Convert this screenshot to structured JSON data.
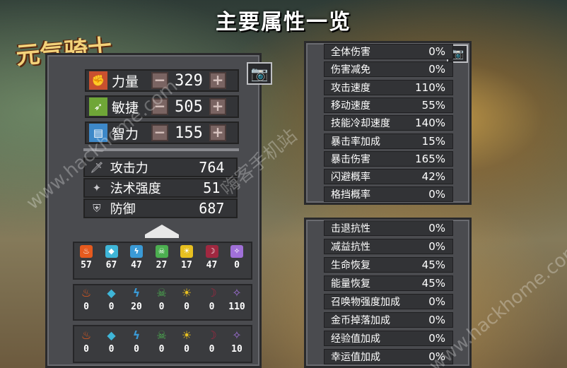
{
  "page_title": "主要属性一览",
  "logo_text": "元气骑士",
  "primary_stats": [
    {
      "icon": "fist-icon",
      "label": "力量",
      "value": "329",
      "color": "#c9502f"
    },
    {
      "icon": "feather-icon",
      "label": "敏捷",
      "value": "505",
      "color": "#6fa637"
    },
    {
      "icon": "book-icon",
      "label": "智力",
      "value": "155",
      "color": "#3d88c8"
    }
  ],
  "derived_stats": [
    {
      "icon": "sword-icon",
      "label": "攻击力",
      "value": "764"
    },
    {
      "icon": "wand-icon",
      "label": "法术强度",
      "value": "51"
    },
    {
      "icon": "shield-icon",
      "label": "防御",
      "value": "687"
    }
  ],
  "element_rows": [
    {
      "name": "shields",
      "values": [
        "57",
        "67",
        "47",
        "27",
        "17",
        "47",
        "0"
      ]
    },
    {
      "name": "elements",
      "values": [
        "0",
        "0",
        "20",
        "0",
        "0",
        "0",
        "110"
      ]
    },
    {
      "name": "weapons",
      "values": [
        "0",
        "0",
        "0",
        "0",
        "0",
        "0",
        "10"
      ]
    }
  ],
  "element_icons": [
    {
      "icon": "fire-icon",
      "color": "#e65a1e"
    },
    {
      "icon": "ice-icon",
      "color": "#3fb6d8"
    },
    {
      "icon": "lightning-icon",
      "color": "#3a9ad6"
    },
    {
      "icon": "poison-icon",
      "color": "#4caf50"
    },
    {
      "icon": "light-icon",
      "color": "#e8c020"
    },
    {
      "icon": "dark-icon",
      "color": "#a02840"
    },
    {
      "icon": "arcane-icon",
      "color": "#a070d8"
    }
  ],
  "attributes_top": [
    {
      "label": "全体伤害",
      "value": "0%"
    },
    {
      "label": "伤害减免",
      "value": "0%"
    },
    {
      "label": "攻击速度",
      "value": "110%"
    },
    {
      "label": "移动速度",
      "value": "55%"
    },
    {
      "label": "技能冷却速度",
      "value": "140%"
    },
    {
      "label": "暴击率加成",
      "value": "15%"
    },
    {
      "label": "暴击伤害",
      "value": "165%"
    },
    {
      "label": "闪避概率",
      "value": "42%"
    },
    {
      "label": "格挡概率",
      "value": "0%"
    }
  ],
  "attributes_bottom": [
    {
      "label": "击退抗性",
      "value": "0%"
    },
    {
      "label": "减益抗性",
      "value": "0%"
    },
    {
      "label": "生命恢复",
      "value": "45%"
    },
    {
      "label": "能量恢复",
      "value": "45%"
    },
    {
      "label": "召唤物强度加成",
      "value": "0%"
    },
    {
      "label": "金币掉落加成",
      "value": "0%"
    },
    {
      "label": "经验值加成",
      "value": "0%"
    },
    {
      "label": "幸运值加成",
      "value": "0%"
    }
  ],
  "watermarks": [
    "www.hackhome.com",
    "嗨客手机站",
    "www.hackhome.com"
  ]
}
